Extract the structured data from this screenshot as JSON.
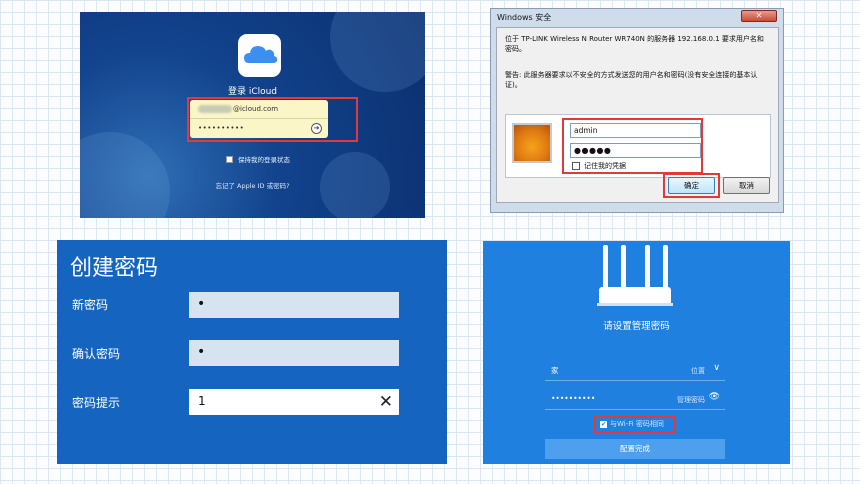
{
  "icloud": {
    "title": "登录 iCloud",
    "email_suffix": "@icloud.com",
    "password_mask": "••••••••••",
    "go_symbol": "➔",
    "keep_signed_in": "保持我的登录状态",
    "forgot": "忘记了 Apple ID 或密码?"
  },
  "windows_dialog": {
    "title": "Windows 安全",
    "close_symbol": "✕",
    "description": "位于 TP-LINK Wireless N Router WR740N 的服务器 192.168.0.1 要求用户名和密码。",
    "warning": "警告: 此服务器要求以不安全的方式发送您的用户名和密码(没有安全连接的基本认证)。",
    "username": "admin",
    "password_mask": "●●●●●",
    "remember": "记住我的凭据",
    "ok": "确定",
    "cancel": "取消"
  },
  "create_password": {
    "title": "创建密码",
    "new_password_label": "新密码",
    "new_password_value": "•",
    "confirm_label": "确认密码",
    "confirm_value": "•",
    "hint_label": "密码提示",
    "hint_value": "1",
    "clear_symbol": "✕"
  },
  "router": {
    "title": "请设置管理密码",
    "location_value": "家",
    "location_label": "位置",
    "dropdown_symbol": "∨",
    "password_mask": "••••••••••",
    "password_label": "管理密码",
    "eye_symbol": "👁",
    "wifi_same": "与Wi-Fi 密码相同",
    "check_symbol": "✔",
    "submit": "配置完成"
  },
  "colors": {
    "highlight_red": "#e03a3a",
    "icloud_blue": "#12438d",
    "create_blue": "#1565c0",
    "router_blue": "#1f80e0"
  }
}
